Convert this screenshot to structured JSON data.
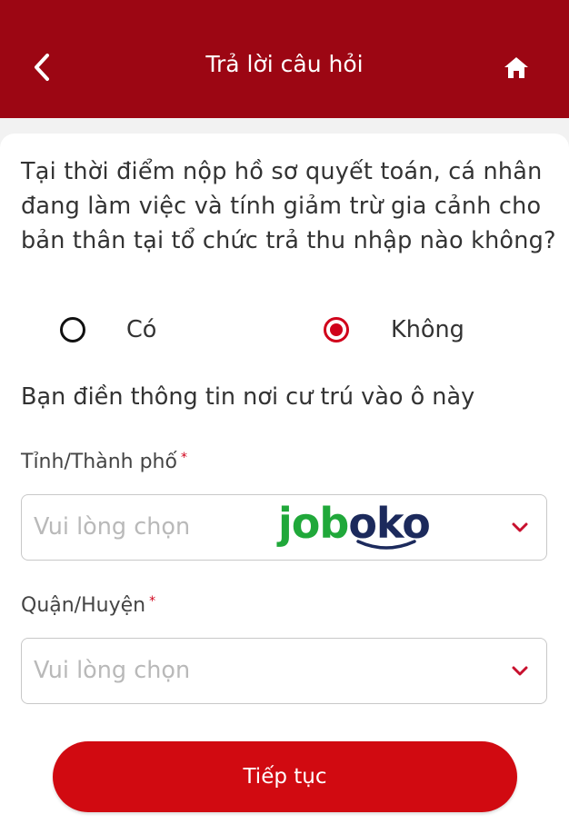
{
  "header": {
    "title": "Trả lời câu hỏi",
    "back_icon": "chevron-left-icon",
    "home_icon": "home-icon"
  },
  "question": {
    "text": "Tại thời điểm nộp hồ sơ quyết toán, cá nhân đang làm việc và tính giảm trừ gia cảnh cho bản thân tại tổ chức trả thu nhập nào không?",
    "options": [
      {
        "label": "Có",
        "selected": false
      },
      {
        "label": "Không",
        "selected": true
      }
    ]
  },
  "residence": {
    "hint": "Bạn điền thông tin nơi cư trú vào ô này",
    "province": {
      "label": "Tỉnh/Thành phố",
      "required_mark": "*",
      "placeholder": "Vui lòng chọn"
    },
    "district": {
      "label": "Quận/Huyện",
      "required_mark": "*",
      "placeholder": "Vui lòng chọn"
    }
  },
  "watermark": {
    "text_green": "job",
    "text_navy": "oko"
  },
  "footer": {
    "continue_label": "Tiếp tục"
  },
  "colors": {
    "header_bg": "#9c0613",
    "accent": "#d0021b",
    "button_bg": "#d10a11",
    "logo_green": "#20a83a",
    "logo_navy": "#1c2a5c"
  }
}
